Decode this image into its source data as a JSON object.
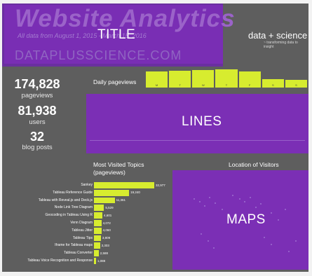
{
  "header": {
    "title": "Website Analytics",
    "subtitle": "All data from August 1, 2015 - March 15, 2016",
    "url": "DATAPLUSSCIENCE.COM",
    "overlay_label": "TITLE",
    "brand": "data + science",
    "tagline": "~ transforming data to insight"
  },
  "stats": [
    {
      "value": "174,828",
      "label": "pageviews"
    },
    {
      "value": "81,938",
      "label": "users"
    },
    {
      "value": "32",
      "label": "blog posts"
    }
  ],
  "daily": {
    "title": "Daily pageviews",
    "days": [
      "M",
      "T",
      "W",
      "T",
      "F",
      "S",
      "S"
    ],
    "values": [
      0.87,
      0.93,
      0.95,
      1.0,
      0.88,
      0.47,
      0.44
    ]
  },
  "lines_label": "LINES",
  "topics": {
    "title_line1": "Most Visited Topics",
    "title_line2": "(pageviews)",
    "items": [
      {
        "label": "Sankey",
        "value": 32977,
        "display": "32,977"
      },
      {
        "label": "Tableau Reference Guide",
        "value": 19240,
        "display": "19,240"
      },
      {
        "label": "Tableau with Reveal.js and Deck.js",
        "value": 11361,
        "display": "11,361"
      },
      {
        "label": "Node Link Tree Diagram",
        "value": 5529,
        "display": "5,529"
      },
      {
        "label": "Geocoding in Tableau Using R",
        "value": 4601,
        "display": "4,601"
      },
      {
        "label": "Venn Diagram",
        "value": 4072,
        "display": "4,072"
      },
      {
        "label": "Tableau Jitter",
        "value": 4060,
        "display": "4,060"
      },
      {
        "label": "Tableau Tips",
        "value": 3809,
        "display": "3,809"
      },
      {
        "label": "Iframe for Tableau maps",
        "value": 3303,
        "display": "3,303"
      },
      {
        "label": "Tableau Converter",
        "value": 2588,
        "display": "2,588"
      },
      {
        "label": "Tableau Voice Recognition and Response",
        "value": 1088,
        "display": "1,088"
      }
    ]
  },
  "map": {
    "title": "Location of Visitors",
    "overlay_label": "MAPS"
  },
  "colors": {
    "background": "#5e5e5e",
    "purple": "#7b2fb5",
    "lime": "#d7ec2f"
  }
}
